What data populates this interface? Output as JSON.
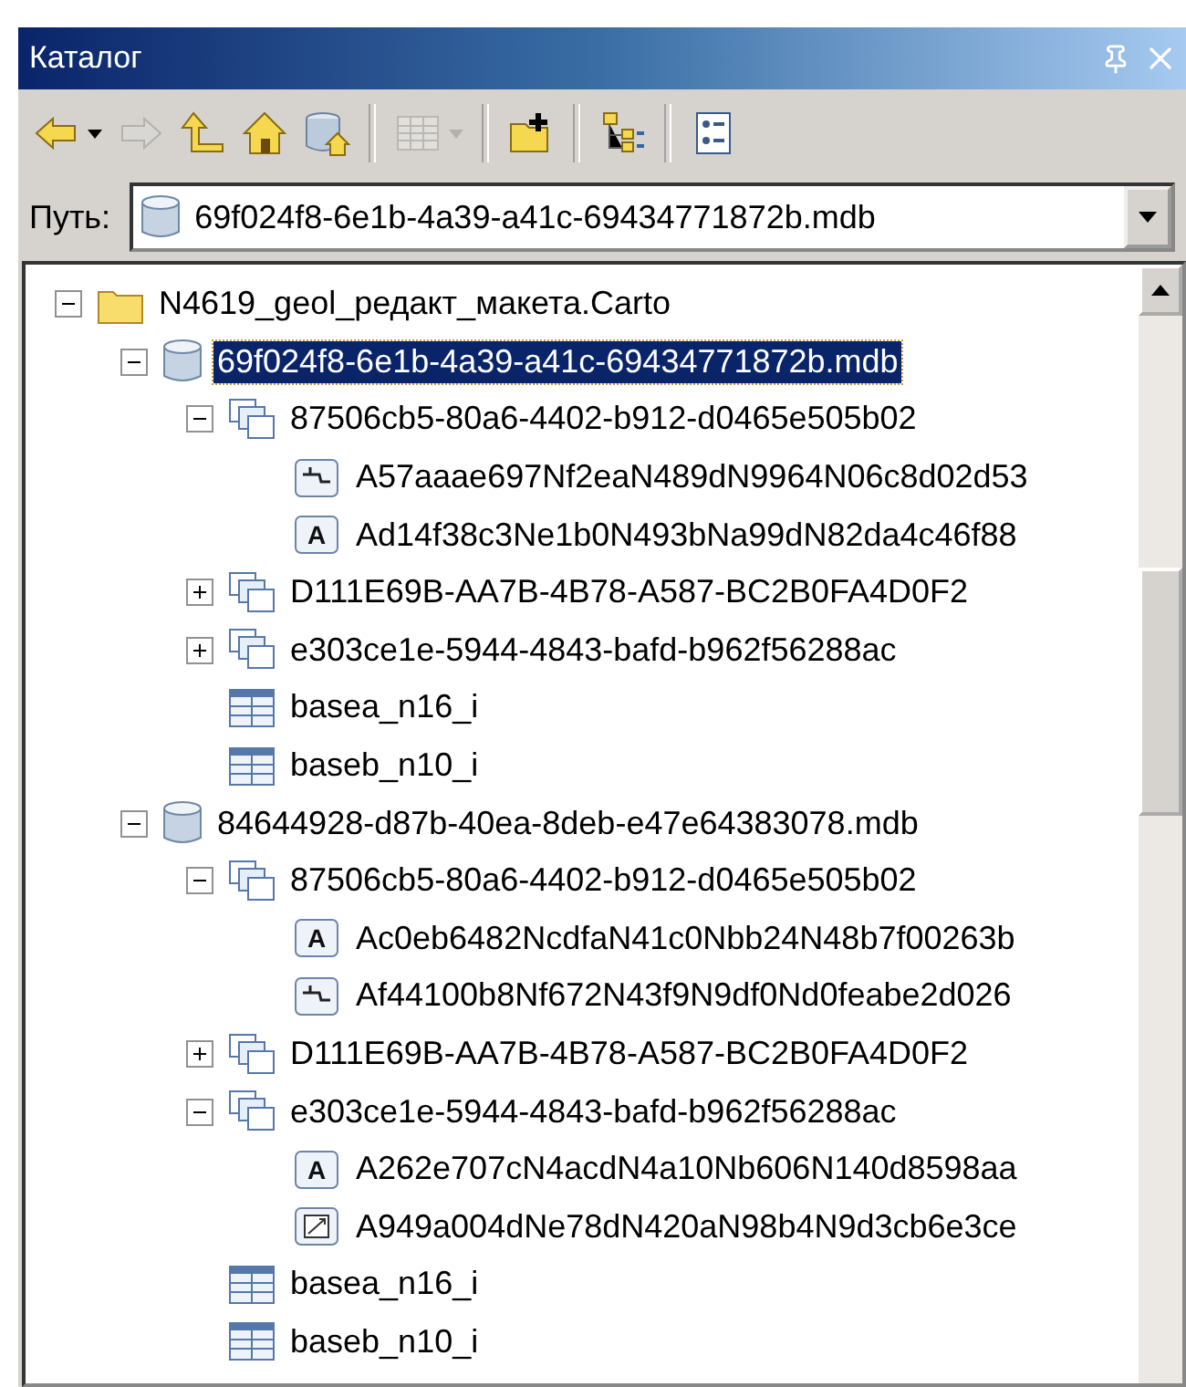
{
  "window": {
    "title": "Каталог"
  },
  "toolbar": [
    [
      {
        "kind": "back",
        "disabled": false,
        "dropdown": true
      },
      {
        "kind": "forward",
        "disabled": true,
        "dropdown": false
      },
      {
        "kind": "up",
        "disabled": false,
        "dropdown": false
      },
      {
        "kind": "home",
        "disabled": false,
        "dropdown": false
      },
      {
        "kind": "dbhome",
        "disabled": false,
        "dropdown": false
      }
    ],
    [
      {
        "kind": "grid",
        "disabled": true,
        "dropdown": true
      }
    ],
    [
      {
        "kind": "connect",
        "disabled": false,
        "dropdown": false
      }
    ],
    [
      {
        "kind": "tree",
        "disabled": false,
        "dropdown": false
      }
    ],
    [
      {
        "kind": "details",
        "disabled": false,
        "dropdown": false
      }
    ]
  ],
  "path": {
    "label": "Путь:",
    "value": "69f024f8-6e1b-4a39-a41c-69434771872b.mdb"
  },
  "tree": [
    {
      "kind": "folder",
      "label": "N4619_geol_редакт_макета.Carto",
      "expanded": true,
      "selected": false,
      "children": [
        {
          "kind": "database",
          "label": "69f024f8-6e1b-4a39-a41c-69434771872b.mdb",
          "expanded": true,
          "selected": true,
          "children": [
            {
              "kind": "dataset",
              "label": "87506cb5-80a6-4402-b912-d0465e505b02",
              "expanded": true,
              "selected": false,
              "children": [
                {
                  "kind": "line",
                  "label": "A57aaae697Nf2eaN489dN9964N06c8d02d53",
                  "selected": false
                },
                {
                  "kind": "annotation",
                  "glyph": "A",
                  "label": "Ad14f38c3Ne1b0N493bNa99dN82da4c46f88",
                  "selected": false
                }
              ]
            },
            {
              "kind": "dataset",
              "label": "D111E69B-AA7B-4B78-A587-BC2B0FA4D0F2",
              "expanded": false,
              "selected": false
            },
            {
              "kind": "dataset",
              "label": "e303ce1e-5944-4843-bafd-b962f56288ac",
              "expanded": false,
              "selected": false
            },
            {
              "kind": "table",
              "label": "basea_n16_i",
              "selected": false
            },
            {
              "kind": "table",
              "label": "baseb_n10_i",
              "selected": false
            }
          ]
        },
        {
          "kind": "database",
          "label": "84644928-d87b-40ea-8deb-e47e64383078.mdb",
          "expanded": true,
          "selected": false,
          "children": [
            {
              "kind": "dataset",
              "label": "87506cb5-80a6-4402-b912-d0465e505b02",
              "expanded": true,
              "selected": false,
              "children": [
                {
                  "kind": "annotation",
                  "glyph": "A",
                  "label": "Ac0eb6482NcdfaN41c0Nbb24N48b7f00263b",
                  "selected": false
                },
                {
                  "kind": "line",
                  "label": "Af44100b8Nf672N43f9N9df0Nd0feabe2d026",
                  "selected": false
                }
              ]
            },
            {
              "kind": "dataset",
              "label": "D111E69B-AA7B-4B78-A587-BC2B0FA4D0F2",
              "expanded": false,
              "selected": false
            },
            {
              "kind": "dataset",
              "label": "e303ce1e-5944-4843-bafd-b962f56288ac",
              "expanded": true,
              "selected": false,
              "children": [
                {
                  "kind": "annotation",
                  "glyph": "A",
                  "label": "A262e707cN4acdN4a10Nb606N140d8598aa",
                  "selected": false
                },
                {
                  "kind": "dimension",
                  "label": "A949a004dNe78dN420aN98b4N9d3cb6e3ce",
                  "selected": false
                }
              ]
            },
            {
              "kind": "table",
              "label": "basea_n16_i",
              "selected": false
            },
            {
              "kind": "table",
              "label": "baseb_n10_i",
              "selected": false
            }
          ]
        }
      ]
    }
  ]
}
